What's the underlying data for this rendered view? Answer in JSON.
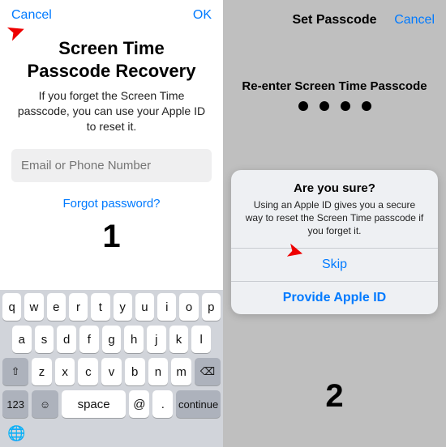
{
  "left": {
    "nav": {
      "cancel": "Cancel",
      "ok": "OK"
    },
    "title_line1": "Screen Time",
    "title_line2": "Passcode Recovery",
    "subtext": "If you forget the Screen Time passcode, you can use your Apple ID to reset it.",
    "input_placeholder": "Email or Phone Number",
    "forgot": "Forgot password?",
    "step_label": "1"
  },
  "keyboard": {
    "row1": [
      "q",
      "w",
      "e",
      "r",
      "t",
      "y",
      "u",
      "i",
      "o",
      "p"
    ],
    "row2": [
      "a",
      "s",
      "d",
      "f",
      "g",
      "h",
      "j",
      "k",
      "l"
    ],
    "row3_shift": "⇧",
    "row3": [
      "z",
      "x",
      "c",
      "v",
      "b",
      "n",
      "m"
    ],
    "row3_del": "⌫",
    "row4": {
      "num": "123",
      "emoji": "☺",
      "space": "space",
      "at": "@",
      "dot": ".",
      "cont": "continue"
    },
    "globe": "🌐"
  },
  "right": {
    "title": "Set Passcode",
    "cancel": "Cancel",
    "subtitle": "Re-enter Screen Time Passcode",
    "step_label": "2"
  },
  "sheet": {
    "title": "Are you sure?",
    "body": "Using an Apple ID gives you a secure way to reset the Screen Time passcode if you forget it.",
    "skip": "Skip",
    "provide": "Provide Apple ID"
  }
}
